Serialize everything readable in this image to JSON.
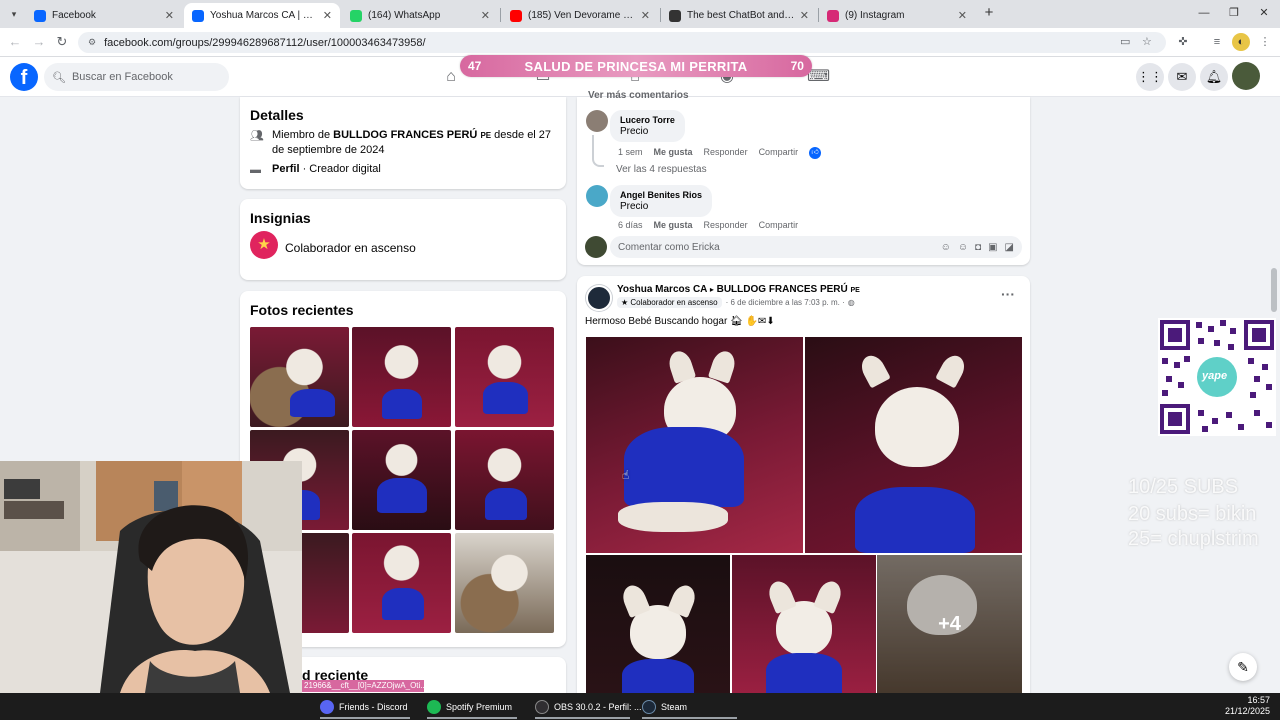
{
  "browser": {
    "tabs": [
      {
        "title": "Facebook",
        "favicon_color": "#0866ff"
      },
      {
        "title": "Yoshua Marcos CA | Facebook",
        "favicon_color": "#0866ff",
        "active": true
      },
      {
        "title": "(164) WhatsApp",
        "favicon_color": "#25d366"
      },
      {
        "title": "(185) Ven Devorame Otra Vez",
        "favicon_color": "#ff0000"
      },
      {
        "title": "The best ChatBot and Widgets",
        "favicon_color": "#333333"
      },
      {
        "title": "(9) Instagram",
        "favicon_color": "#d62976"
      }
    ],
    "url": "facebook.com/groups/299946289687112/user/100003463473958/"
  },
  "facebook": {
    "search_placeholder": "Buscar en Facebook"
  },
  "overlay": {
    "banner_left": "47",
    "banner_title": "SALUD DE PRINCESA MI PERRITA",
    "banner_right": "70",
    "subs_lines": [
      "10/25 SUBS",
      "20 subs= bikin",
      "25= chuplstrim"
    ],
    "qr_label": "yape"
  },
  "details": {
    "title": "Detalles",
    "member_prefix": "Miembro de ",
    "member_group": "BULLDOG FRANCES PERÚ",
    "member_flag": "PE",
    "member_suffix": " desde el 27 de septiembre de 2024",
    "profile_label": "Perfil",
    "profile_suffix": " · Creador digital"
  },
  "badges": {
    "title": "Insignias",
    "badge_name": "Colaborador en ascenso"
  },
  "photos": {
    "title": "Fotos recientes"
  },
  "recent": {
    "title_partial": "d reciente",
    "tooltip": "21966&__cft__[0]=AZZOjwA_Oti..."
  },
  "comments": {
    "see_more": "Ver más comentarios",
    "items": [
      {
        "name": "Lucero Torre",
        "text": "Precio",
        "time": "1 sem",
        "like": "Me gusta",
        "reply": "Responder",
        "share": "Compartir"
      },
      {
        "name": "Angel Benites Rios",
        "text": "Precio",
        "time": "6 días",
        "like": "Me gusta",
        "reply": "Responder",
        "share": "Compartir"
      }
    ],
    "see_replies": "Ver las 4 respuestas",
    "input_placeholder": "Comentar como Ericka"
  },
  "post": {
    "author": "Yoshua Marcos CA",
    "group": "BULLDOG FRANCES PERÚ",
    "flag": "PE",
    "badge": "Colaborador en ascenso",
    "date": "· 6 de diciembre a las 7:03 p. m. ·",
    "text": "Hermoso Bebé Buscando hogar",
    "more_photos": "+4"
  },
  "taskbar": {
    "items": [
      {
        "label": "Friends - Discord",
        "color": "#5865f2"
      },
      {
        "label": "Spotify Premium",
        "color": "#1db954"
      },
      {
        "label": "OBS 30.0.2 - Perfil: ...",
        "color": "#302e31"
      },
      {
        "label": "Steam",
        "color": "#1b2838"
      }
    ],
    "time": "16:57",
    "date": "21/12/2025"
  }
}
